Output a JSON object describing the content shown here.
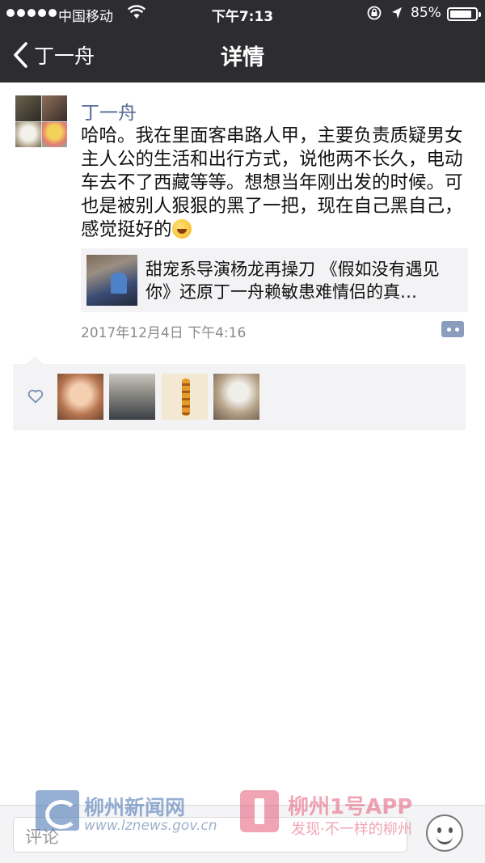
{
  "status_bar": {
    "carrier": "中国移动",
    "time": "下午7:13",
    "battery_percent": "85%",
    "battery_level": 0.85,
    "icons": [
      "signal-dots-icon",
      "wifi-icon",
      "rotation-lock-icon",
      "location-arrow-icon",
      "battery-icon"
    ]
  },
  "nav": {
    "back_label": "丁一舟",
    "title": "详情"
  },
  "post": {
    "author": "丁一舟",
    "text": "哈哈。我在里面客串路人甲，主要负责质疑男女主人公的生活和出行方式，说他两不长久，电动车去不了西藏等等。想想当年刚出发的时候。可也是被别人狠狠的黑了一把，现在自己黑自己，感觉挺好的",
    "emoji": "laughing-tears-emoji",
    "link_card": {
      "title": "甜宠系导演杨龙再操刀 《假如没有遇见你》还原丁一舟赖敏患难情侣的真…"
    },
    "timestamp": "2017年12月4日 下午4:16"
  },
  "likes": {
    "icon": "heart-outline-icon",
    "count_avatars": 4
  },
  "comment_bar": {
    "placeholder": "评论",
    "emoji_button_icon": "smiley-icon"
  },
  "watermark": {
    "site_name": "柳州新闻网",
    "site_url": "www.lznews.gov.cn",
    "app_name": "柳州1号APP",
    "app_slogan": "发现·不一样的柳州"
  },
  "colors": {
    "nav_background": "#2d2d31",
    "author_link": "#576b95",
    "likes_background": "#f3f3f5",
    "timestamp": "#8a8a8a"
  }
}
